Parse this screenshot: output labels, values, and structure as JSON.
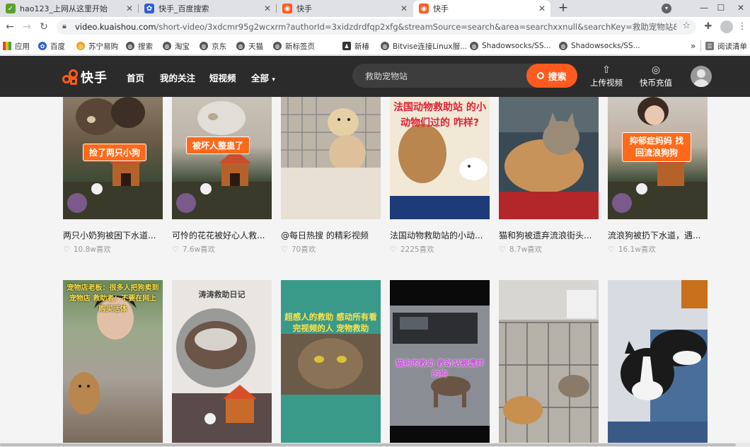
{
  "browser": {
    "tabs": [
      {
        "title": "hao123_上网从这里开始",
        "icon": "hao123-icon",
        "color": "#5aa02c"
      },
      {
        "title": "快手_百度搜索",
        "icon": "baidu-paw-icon",
        "color": "#3060d8"
      },
      {
        "title": "快手",
        "icon": "kuaishou-icon",
        "color": "#ff5a1f"
      },
      {
        "title": "快手",
        "icon": "kuaishou-icon",
        "color": "#ff5a1f"
      }
    ],
    "new_tab": "+",
    "url_host": "video.kuaishou.com",
    "url_path": "/short-video/3xdcmr95g2wcxrm?authorId=3xidzdrdfqp2xfg&streamSource=search&area=searchxxnull&searchKey=救助宠物站&curr...",
    "bookmarks": [
      {
        "label": "应用",
        "icon": "apps-grid-icon"
      },
      {
        "label": "百度",
        "icon": "baidu-paw-icon"
      },
      {
        "label": "苏宁易购",
        "icon": "suning-icon"
      },
      {
        "label": "搜索",
        "icon": "globe-icon"
      },
      {
        "label": "淘宝",
        "icon": "globe-icon"
      },
      {
        "label": "京东",
        "icon": "globe-icon"
      },
      {
        "label": "天猫",
        "icon": "globe-icon"
      },
      {
        "label": "新标签页",
        "icon": "globe-icon"
      },
      {
        "label": "新椿",
        "icon": "person-icon"
      },
      {
        "label": "Bitvise连接Linux服...",
        "icon": "globe-icon"
      },
      {
        "label": "Shadowsocks/SS...",
        "icon": "globe-icon"
      },
      {
        "label": "Shadowsocks/SS...",
        "icon": "globe-icon"
      }
    ],
    "more_bookmarks": "»",
    "reading_list": "阅读清单"
  },
  "site": {
    "logo_text": "快手",
    "nav": [
      "首页",
      "我的关注",
      "短视频",
      "全部"
    ],
    "search_value": "救助宠物站",
    "search_button": "搜索",
    "upload_label": "上传视频",
    "recharge_label": "快币充值",
    "brand_color": "#ff5a1f"
  },
  "videos": [
    {
      "title": "两只小奶狗被困下水道...",
      "likes": "10.8w喜欢",
      "caption": "捡了两只小狗"
    },
    {
      "title": "可怜的花花被好心人救...",
      "likes": "7.6w喜欢",
      "caption": "被坏人整蛊了"
    },
    {
      "title": "@每日热搜 的精彩视频",
      "likes": "70喜欢",
      "caption": ""
    },
    {
      "title": "法国动物救助站的小动...",
      "likes": "2225喜欢",
      "caption": "法国动物救助站 的小动物们过的 咋样?"
    },
    {
      "title": "猫和狗被遗弃流浪街头...",
      "likes": "8.7w喜欢",
      "caption": ""
    },
    {
      "title": "流浪狗被扔下水道，遇...",
      "likes": "16.1w喜欢",
      "caption": "抑郁症妈妈 找回流浪狗狗"
    },
    {
      "title": "",
      "likes": "",
      "caption": "宠物店老板：很多人把狗卖到宠物店 救助者：不要在网上购买活体"
    },
    {
      "title": "",
      "likes": "",
      "caption": "涛涛救助日记"
    },
    {
      "title": "",
      "likes": "",
      "caption": "超感人的救助 感动所有看完视频的人 宠物救助"
    },
    {
      "title": "",
      "likes": "",
      "caption": "猫狗的救助 救助站被遗弃的狗"
    },
    {
      "title": "",
      "likes": "",
      "caption": ""
    },
    {
      "title": "",
      "likes": "",
      "caption": ""
    }
  ]
}
